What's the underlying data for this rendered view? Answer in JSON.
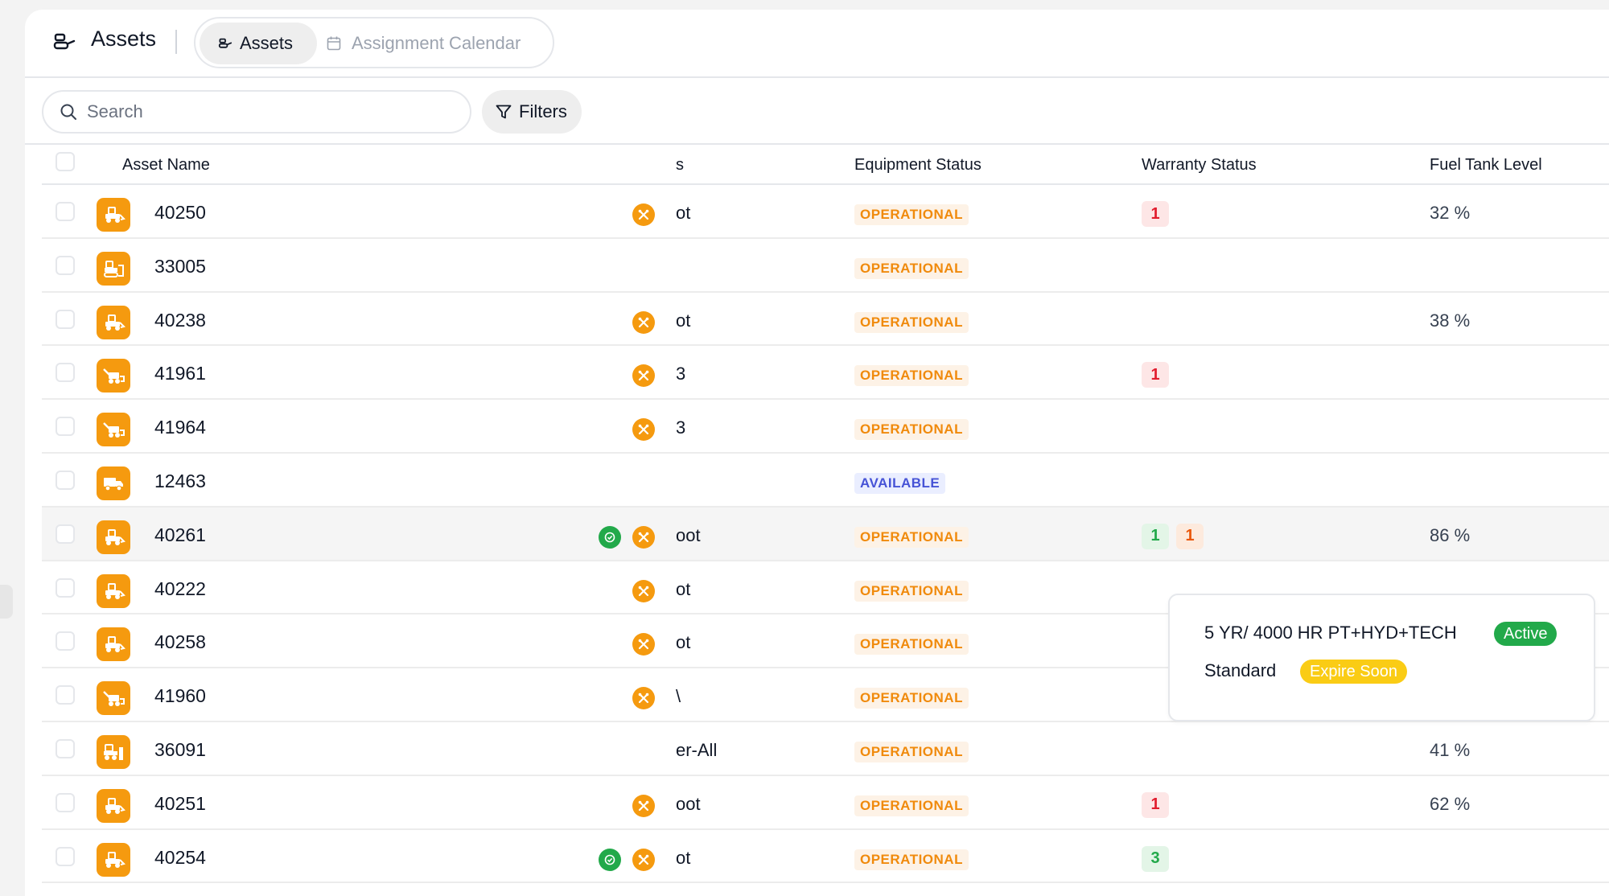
{
  "header": {
    "title": "Assets",
    "tabs": [
      {
        "label": "Assets",
        "active": true
      },
      {
        "label": "Assignment Calendar",
        "active": false
      }
    ]
  },
  "toolbar": {
    "search_placeholder": "Search",
    "filters_label": "Filters"
  },
  "table": {
    "columns": {
      "asset_name": "Asset Name",
      "partial": "s",
      "equipment_status": "Equipment Status",
      "warranty_status": "Warranty Status",
      "fuel_tank_level": "Fuel Tank Level"
    },
    "rows": [
      {
        "name": "40250",
        "icon": "loader-icon",
        "ok": false,
        "tool": true,
        "frag": "ot",
        "status": "OPERATIONAL",
        "warranty": [
          {
            "v": "1",
            "c": "red"
          }
        ],
        "fuel": "32 %"
      },
      {
        "name": "33005",
        "icon": "bulldozer-icon",
        "ok": false,
        "tool": false,
        "frag": "",
        "status": "OPERATIONAL",
        "warranty": [],
        "fuel": ""
      },
      {
        "name": "40238",
        "icon": "loader-icon",
        "ok": false,
        "tool": true,
        "frag": "ot",
        "status": "OPERATIONAL",
        "warranty": [],
        "fuel": "38 %"
      },
      {
        "name": "41961",
        "icon": "paver-icon",
        "ok": false,
        "tool": true,
        "frag": "3",
        "status": "OPERATIONAL",
        "warranty": [
          {
            "v": "1",
            "c": "red"
          }
        ],
        "fuel": ""
      },
      {
        "name": "41964",
        "icon": "paver-icon",
        "ok": false,
        "tool": true,
        "frag": "3",
        "status": "OPERATIONAL",
        "warranty": [],
        "fuel": ""
      },
      {
        "name": "12463",
        "icon": "truck-icon",
        "ok": false,
        "tool": false,
        "frag": "",
        "status": "AVAILABLE",
        "warranty": [],
        "fuel": ""
      },
      {
        "name": "40261",
        "icon": "loader-icon",
        "ok": true,
        "tool": true,
        "frag": "oot",
        "status": "OPERATIONAL",
        "warranty": [
          {
            "v": "1",
            "c": "green"
          },
          {
            "v": "1",
            "c": "orange"
          }
        ],
        "fuel": "86 %",
        "highlight": true
      },
      {
        "name": "40222",
        "icon": "loader-icon",
        "ok": false,
        "tool": true,
        "frag": "ot",
        "status": "OPERATIONAL",
        "warranty": [],
        "fuel": ""
      },
      {
        "name": "40258",
        "icon": "loader-icon",
        "ok": false,
        "tool": true,
        "frag": "ot",
        "status": "OPERATIONAL",
        "warranty": [],
        "fuel": ""
      },
      {
        "name": "41960",
        "icon": "paver-icon",
        "ok": false,
        "tool": true,
        "frag": "\\",
        "status": "OPERATIONAL",
        "warranty": [],
        "fuel": ""
      },
      {
        "name": "36091",
        "icon": "dozer-icon",
        "ok": false,
        "tool": false,
        "frag": "er-All",
        "status": "OPERATIONAL",
        "warranty": [],
        "fuel": "41 %"
      },
      {
        "name": "40251",
        "icon": "loader-icon",
        "ok": false,
        "tool": true,
        "frag": "oot",
        "status": "OPERATIONAL",
        "warranty": [
          {
            "v": "1",
            "c": "red"
          }
        ],
        "fuel": "62 %"
      },
      {
        "name": "40254",
        "icon": "loader-icon",
        "ok": true,
        "tool": true,
        "frag": "ot",
        "status": "OPERATIONAL",
        "warranty": [
          {
            "v": "3",
            "c": "green"
          }
        ],
        "fuel": ""
      }
    ]
  },
  "warranty_popup": {
    "items": [
      {
        "name": "5 YR/ 4000 HR PT+HYD+TECH",
        "badge": "Active"
      },
      {
        "name": "Standard",
        "badge": "Expire Soon"
      }
    ]
  },
  "colors": {
    "accent_orange": "#f59a0f",
    "ok_green": "#22a94a",
    "warn_red": "#e11d2e",
    "available_blue": "#4653d6",
    "expire_yellow": "#facc15"
  }
}
